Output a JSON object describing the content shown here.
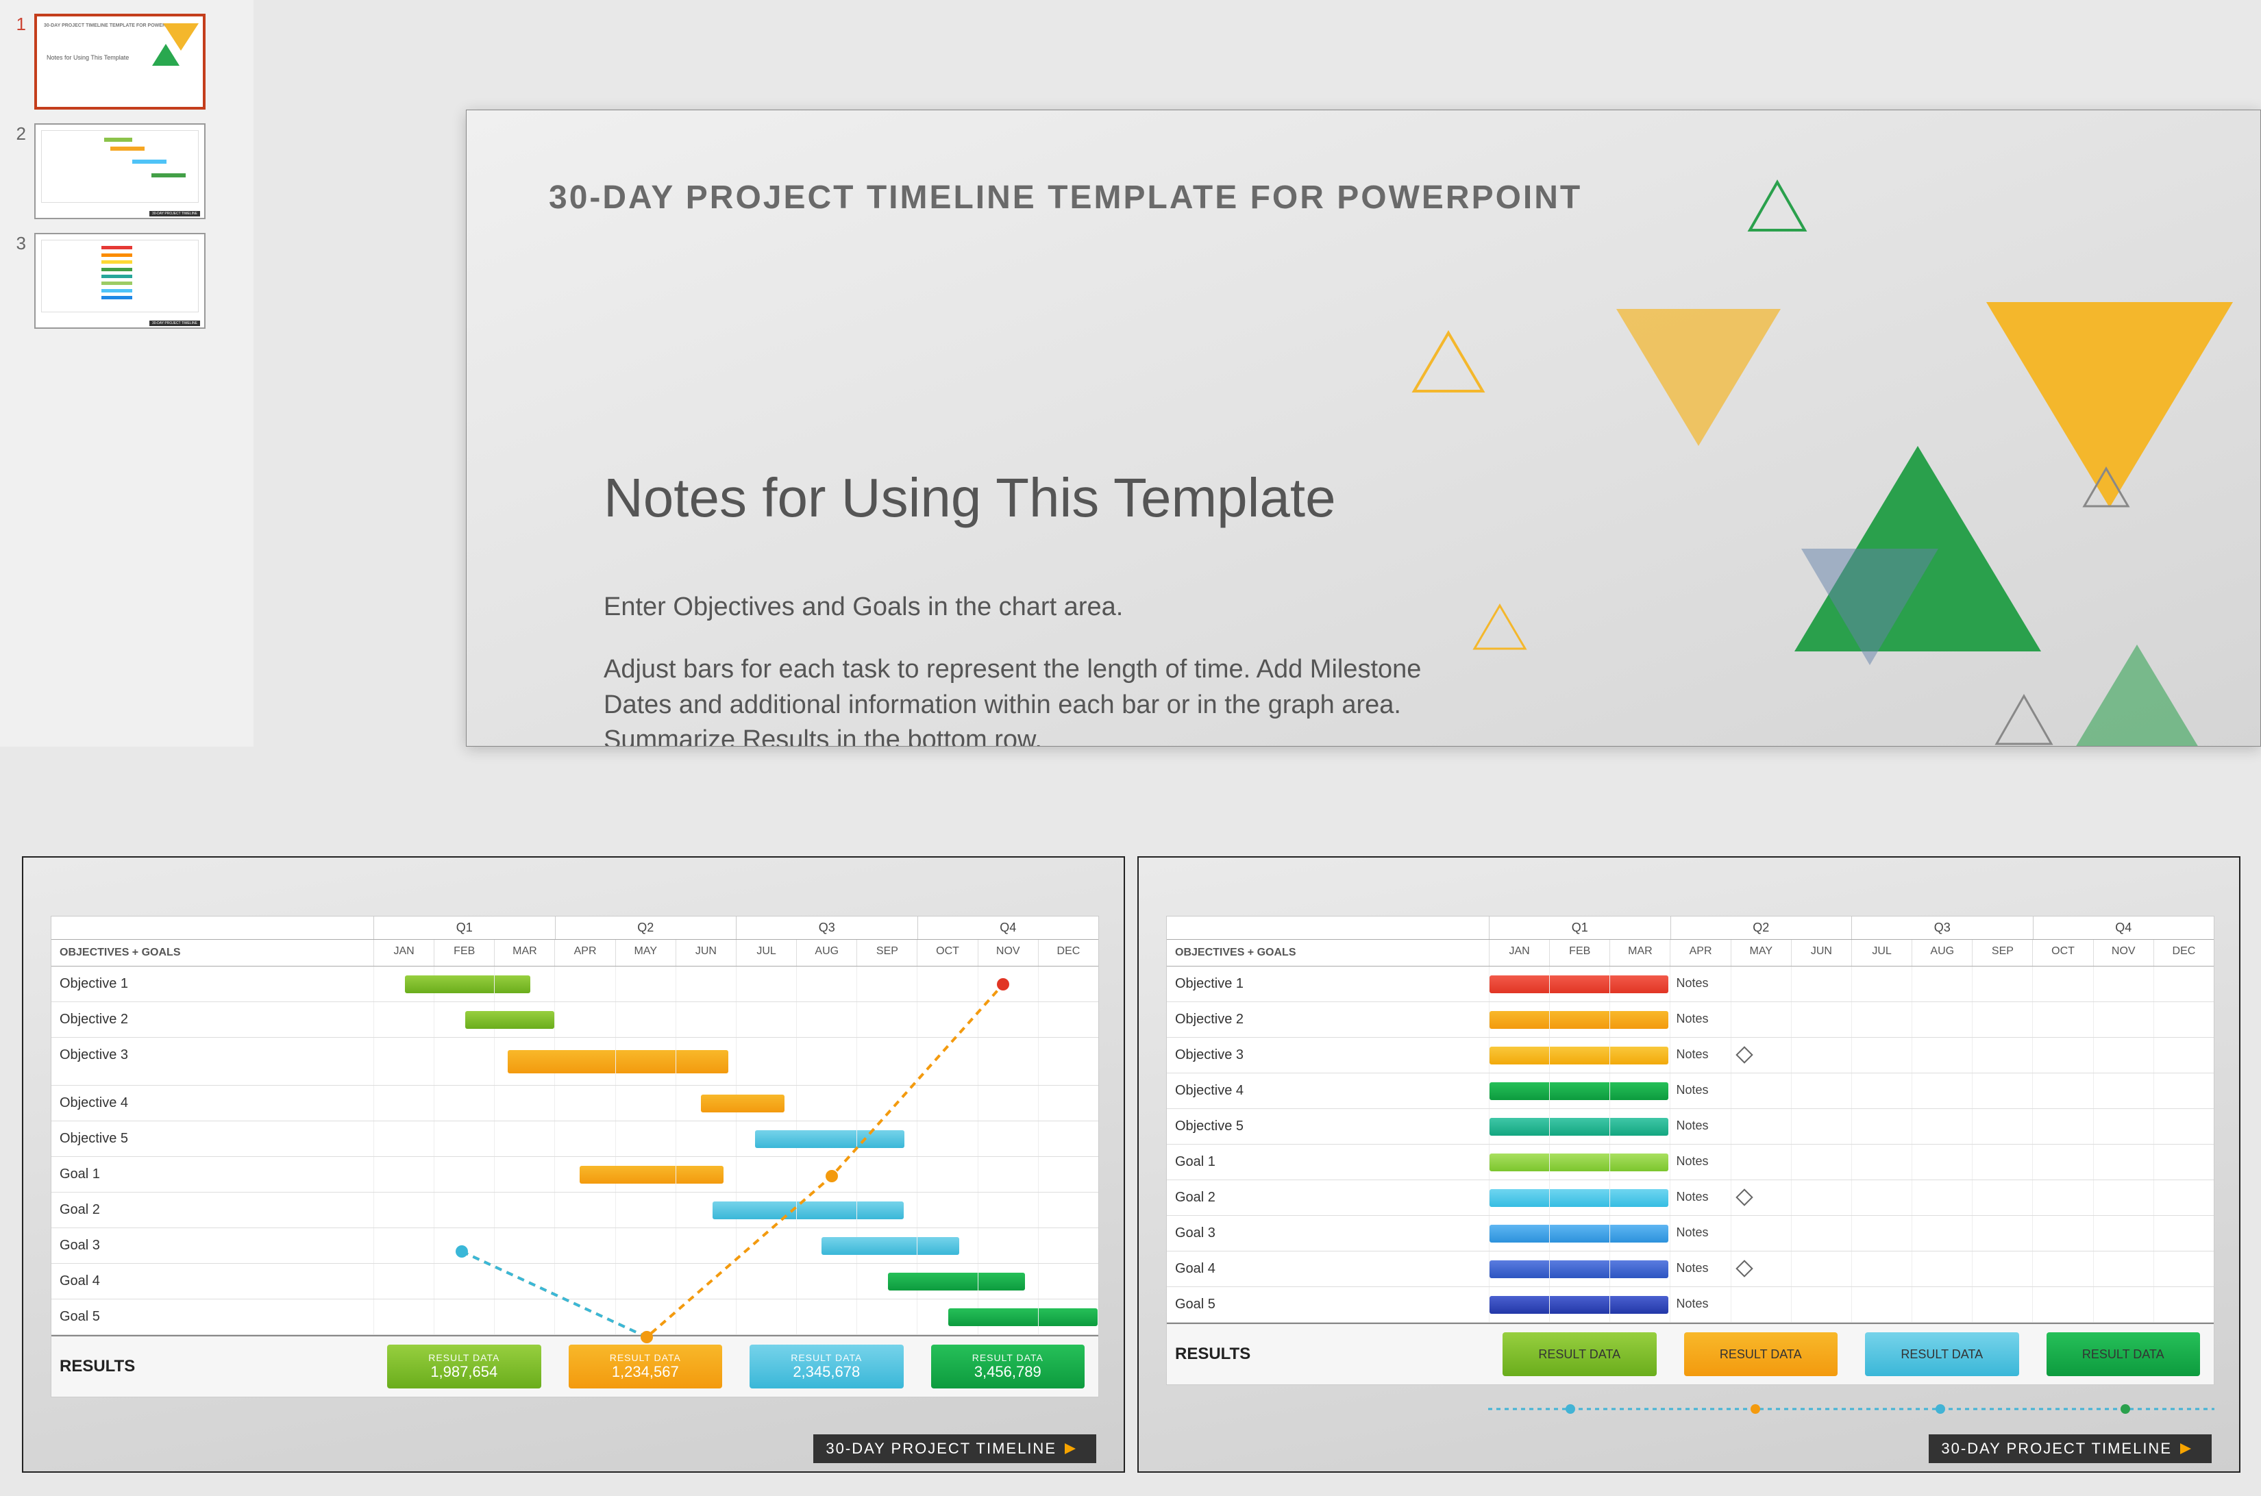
{
  "thumbnails": [
    "1",
    "2",
    "3"
  ],
  "main": {
    "title": "30-DAY PROJECT TIMELINE TEMPLATE FOR POWERPOINT",
    "subtitle": "Notes for Using This Template",
    "p1": "Enter Objectives and Goals in the chart area.",
    "p2": "Adjust bars for each task to represent the length of time.  Add Milestone Dates and additional information within each bar or in the graph area. Summarize Results in the bottom row."
  },
  "gantt": {
    "objLabel": "OBJECTIVES + GOALS",
    "quarters": [
      "Q1",
      "Q2",
      "Q3",
      "Q4"
    ],
    "months": [
      "JAN",
      "FEB",
      "MAR",
      "APR",
      "MAY",
      "JUN",
      "JUL",
      "AUG",
      "SEP",
      "OCT",
      "NOV",
      "DEC"
    ],
    "rowsLeft": [
      "Objective 1",
      "Objective 2",
      "Objective 3",
      "Objective 4",
      "Objective 5",
      "Goal 1",
      "Goal 2",
      "Goal 3",
      "Goal 4",
      "Goal 5"
    ],
    "rowsRight": [
      "Objective 1",
      "Objective 2",
      "Objective 3",
      "Objective 4",
      "Objective 5",
      "Goal 1",
      "Goal 2",
      "Goal 3",
      "Goal 4",
      "Goal 5"
    ],
    "resultsLabel": "RESULTS",
    "resultDataLabel": "RESULT DATA",
    "resultValues": [
      "1,987,654",
      "1,234,567",
      "2,345,678",
      "3,456,789"
    ],
    "notesLabel": "Notes",
    "footer": "30-DAY PROJECT TIMELINE"
  },
  "chart_data": [
    {
      "type": "bar",
      "title": "30-DAY PROJECT TIMELINE (Gantt, left)",
      "categories": [
        "Objective 1",
        "Objective 2",
        "Objective 3",
        "Objective 4",
        "Objective 5",
        "Goal 1",
        "Goal 2",
        "Goal 3",
        "Goal 4",
        "Goal 5"
      ],
      "series": [
        {
          "name": "start_month",
          "values": [
            1,
            2,
            3,
            6,
            7,
            4,
            6,
            8,
            9,
            10
          ]
        },
        {
          "name": "end_month",
          "values": [
            3,
            3,
            6,
            7,
            9,
            6,
            9,
            10,
            11,
            12
          ]
        }
      ],
      "line_overlay": {
        "x": [
          2,
          5,
          8,
          11
        ],
        "y": [
          6,
          9,
          4,
          0
        ]
      },
      "x_ticks": [
        "JAN",
        "FEB",
        "MAR",
        "APR",
        "MAY",
        "JUN",
        "JUL",
        "AUG",
        "SEP",
        "OCT",
        "NOV",
        "DEC"
      ],
      "quarters": [
        "Q1",
        "Q2",
        "Q3",
        "Q4"
      ],
      "results": [
        1987654,
        1234567,
        2345678,
        3456789
      ]
    },
    {
      "type": "bar",
      "title": "30-DAY PROJECT TIMELINE (Gantt, right)",
      "categories": [
        "Objective 1",
        "Objective 2",
        "Objective 3",
        "Objective 4",
        "Objective 5",
        "Goal 1",
        "Goal 2",
        "Goal 3",
        "Goal 4",
        "Goal 5"
      ],
      "series": [
        {
          "name": "start_month",
          "values": [
            1,
            1,
            1,
            1,
            1,
            1,
            1,
            1,
            1,
            1
          ]
        },
        {
          "name": "end_month",
          "values": [
            3,
            3,
            3,
            3,
            3,
            3,
            3,
            3,
            3,
            3
          ]
        }
      ],
      "notes_column": true,
      "milestone_rows": [
        3,
        7,
        9
      ],
      "x_ticks": [
        "JAN",
        "FEB",
        "MAR",
        "APR",
        "MAY",
        "JUN",
        "JUL",
        "AUG",
        "SEP",
        "OCT",
        "NOV",
        "DEC"
      ],
      "quarters": [
        "Q1",
        "Q2",
        "Q3",
        "Q4"
      ],
      "results": [
        "RESULT DATA",
        "RESULT DATA",
        "RESULT DATA",
        "RESULT DATA"
      ]
    }
  ]
}
